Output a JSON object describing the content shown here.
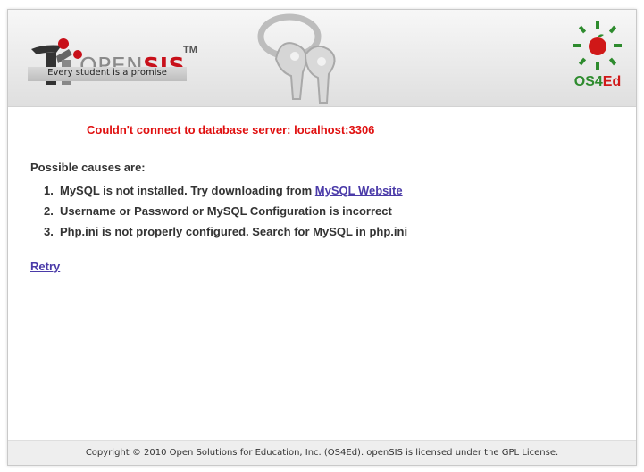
{
  "header": {
    "brand_open": "OPEN",
    "brand_sis": "SIS",
    "brand_tm": "TM",
    "tagline": "Every student is a promise",
    "partner_os4": "OS4",
    "partner_ed": "Ed"
  },
  "error": {
    "message": "Couldn't connect to database server: localhost:3306"
  },
  "causes": {
    "title": "Possible causes are:",
    "items": [
      {
        "num": "1.",
        "text": "MySQL is not installed. Try downloading from ",
        "link": "MySQL Website"
      },
      {
        "num": "2.",
        "text": "Username or Password or MySQL Configuration is incorrect"
      },
      {
        "num": "3.",
        "text": "Php.ini is not properly configured. Search for MySQL in php.ini"
      }
    ]
  },
  "retry_label": "Retry",
  "footer": {
    "copyright": "Copyright © 2010 Open Solutions for Education, Inc. (OS4Ed). openSIS is licensed under the GPL License."
  },
  "colors": {
    "error": "#e01010",
    "link": "#4a3aa8",
    "brand_red": "#c8101a",
    "os4ed_green": "#2e8b2e"
  }
}
